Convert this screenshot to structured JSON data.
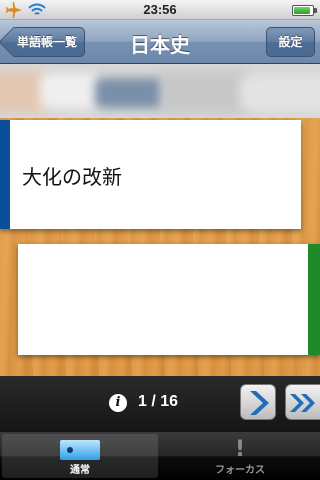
{
  "status_bar": {
    "time": "23:56",
    "airplane_icon": "airplane-icon",
    "wifi_icon": "wifi-icon",
    "battery_icon": "battery-icon",
    "battery_level": 0.9
  },
  "nav": {
    "back_label": "単語帳一覧",
    "title": "日本史",
    "settings_label": "設定"
  },
  "card": {
    "term": "大化の改新",
    "answer": "",
    "front_stripe_color": "#0a4f9a",
    "back_stripe_color": "#1e8a2a"
  },
  "controls": {
    "info_icon": "info-icon",
    "info_glyph": "i",
    "page_counter": "1 / 16",
    "next_icon": "chevron-right-icon",
    "last_icon": "double-chevron-right-icon"
  },
  "tabs": [
    {
      "label": "通常",
      "icon": "card-icon",
      "selected": true
    },
    {
      "label": "フォーカス",
      "icon": "exclamation-icon",
      "glyph": "!",
      "selected": false
    }
  ],
  "colors": {
    "nav_accent": "#6d88aa",
    "wood": "#e09a45",
    "button_blue": "#1f6fb8"
  }
}
